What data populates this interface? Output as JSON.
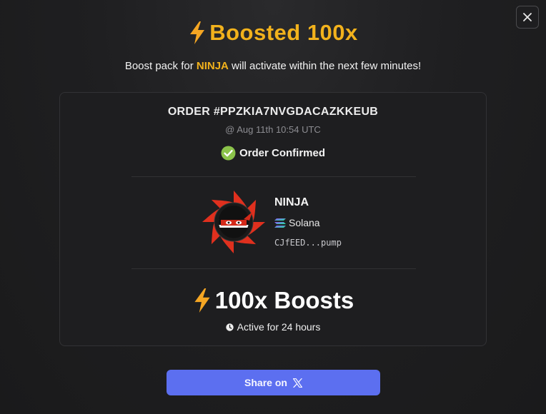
{
  "modal": {
    "title": "Boosted 100x",
    "subtitle_prefix": "Boost pack for ",
    "subtitle_token": "NINJA",
    "subtitle_suffix": " will activate within the next few minutes!",
    "close_icon": "close-icon",
    "accent_color": "#f2b21c"
  },
  "order": {
    "id_label": "ORDER #PPZKIA7NVGDACAZKKEUB",
    "timestamp": "@ Aug 11th 10:54 UTC",
    "status": "Order Confirmed",
    "status_icon": "check-circle-icon",
    "status_color": "#8bc34a"
  },
  "token": {
    "name": "NINJA",
    "chain": "Solana",
    "chain_icon": "solana-icon",
    "address": "CJfEED...pump",
    "logo_icon": "ninja-shuriken-logo"
  },
  "boost": {
    "label": "100x Boosts",
    "icon": "lightning-icon",
    "duration": "Active for 24 hours",
    "duration_icon": "clock-icon"
  },
  "share": {
    "label": "Share on",
    "icon": "x-logo-icon",
    "button_color": "#5c6ff0"
  }
}
